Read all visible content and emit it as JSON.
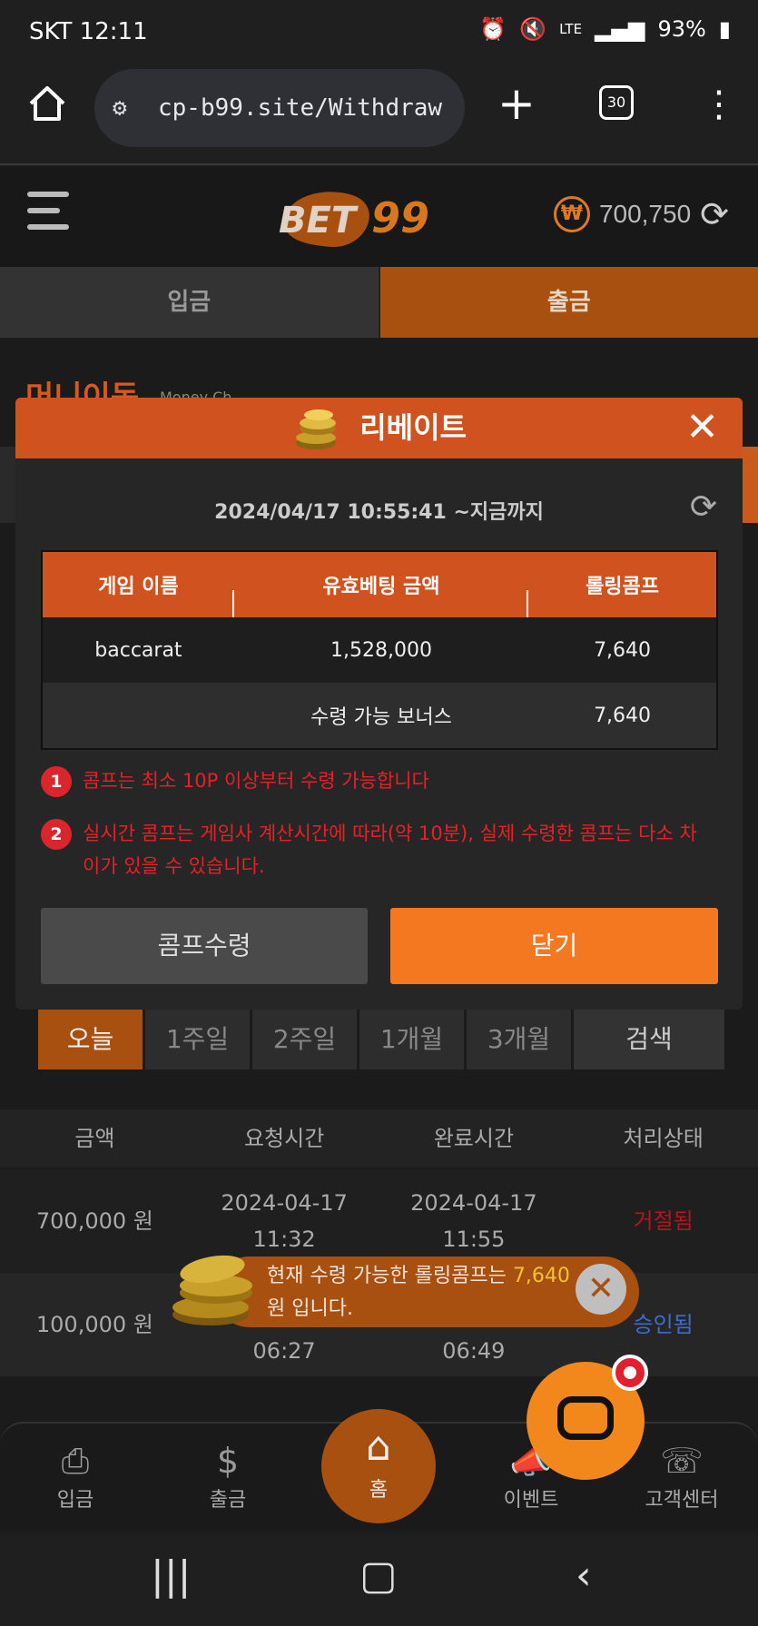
{
  "status_bar": {
    "carrier_time": "SKT 12:11",
    "network": "LTE",
    "battery": "93%"
  },
  "browser": {
    "url": "cp-b99.site/Withdraw",
    "tab_count": "30"
  },
  "header": {
    "logo_text": "BET99",
    "currency_symbol": "₩",
    "balance": "700,750"
  },
  "main_tabs": [
    {
      "label": "입금"
    },
    {
      "label": "출금"
    }
  ],
  "background": {
    "title": "머니이동",
    "subtitle": "Money Ch",
    "period_buttons": [
      {
        "label": "오늘"
      },
      {
        "label": "1주일"
      },
      {
        "label": "2주일"
      },
      {
        "label": "1개월"
      },
      {
        "label": "3개월"
      }
    ],
    "search_label": "검색",
    "history_headers": [
      "금액",
      "요청시간",
      "완료시간",
      "처리상태"
    ],
    "history_rows": [
      {
        "amount": "700,000 원",
        "req_date": "2024-04-17",
        "req_time": "11:32",
        "done_date": "2024-04-17",
        "done_time": "11:55",
        "status": "거절됨"
      },
      {
        "amount": "100,000 원",
        "req_date": "",
        "req_time": "06:27",
        "done_date": "",
        "done_time": "06:49",
        "status": "승인됨"
      }
    ]
  },
  "modal": {
    "title": "리베이트",
    "period": "2024/04/17 10:55:41 ~지금까지",
    "table_headers": [
      "게임 이름",
      "유효베팅 금액",
      "롤링콤프"
    ],
    "rows": [
      {
        "game": "baccarat",
        "valid_bet": "1,528,000",
        "comp": "7,640"
      }
    ],
    "bonus_label": "수령 가능 보너스",
    "bonus_value": "7,640",
    "notes": [
      {
        "num": "1",
        "text": "콤프는 최소 10P 이상부터 수령 가능합니다"
      },
      {
        "num": "2",
        "text": "실시간 콤프는 게임사 계산시간에 따라(약 10분), 실제 수령한 콤프는 다소 차이가 있을 수 있습니다."
      }
    ],
    "claim_label": "콤프수령",
    "close_label": "닫기"
  },
  "toast": {
    "text_before": "현재 수령 가능한 롤링콤프는 ",
    "highlight": "7,640",
    "text_after": " 원 입니다."
  },
  "bottom_nav": [
    {
      "label": "입금",
      "icon": "deposit-icon"
    },
    {
      "label": "출금",
      "icon": "withdraw-icon"
    },
    {
      "label": "홈",
      "icon": "home-icon"
    },
    {
      "label": "이벤트",
      "icon": "event-icon"
    },
    {
      "label": "고객센터",
      "icon": "support-24-icon"
    }
  ],
  "support_badge": "24",
  "colors": {
    "accent": "#d0521f",
    "orange_button": "#f47820",
    "error_red": "#e82026",
    "approved_blue": "#3f6cc8"
  }
}
